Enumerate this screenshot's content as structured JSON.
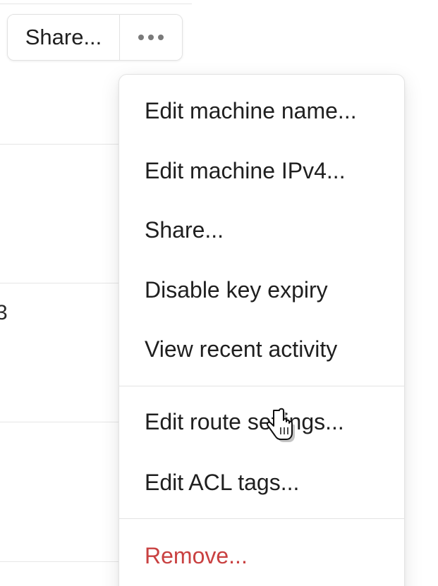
{
  "toolbar": {
    "share_label": "Share...",
    "more_icon": "ellipsis-horizontal"
  },
  "background": {
    "cell_text": "3"
  },
  "menu": {
    "items": [
      {
        "label": "Edit machine name..."
      },
      {
        "label": "Edit machine IPv4..."
      },
      {
        "label": "Share..."
      },
      {
        "label": "Disable key expiry"
      },
      {
        "label": "View recent activity"
      },
      {
        "label": "Edit route settings..."
      },
      {
        "label": "Edit ACL tags..."
      },
      {
        "label": "Remove..."
      }
    ]
  },
  "colors": {
    "danger": "#c94141",
    "text": "#1f1f1f",
    "border": "#e3e3e3"
  },
  "cursor_icon": "hand-pointer"
}
